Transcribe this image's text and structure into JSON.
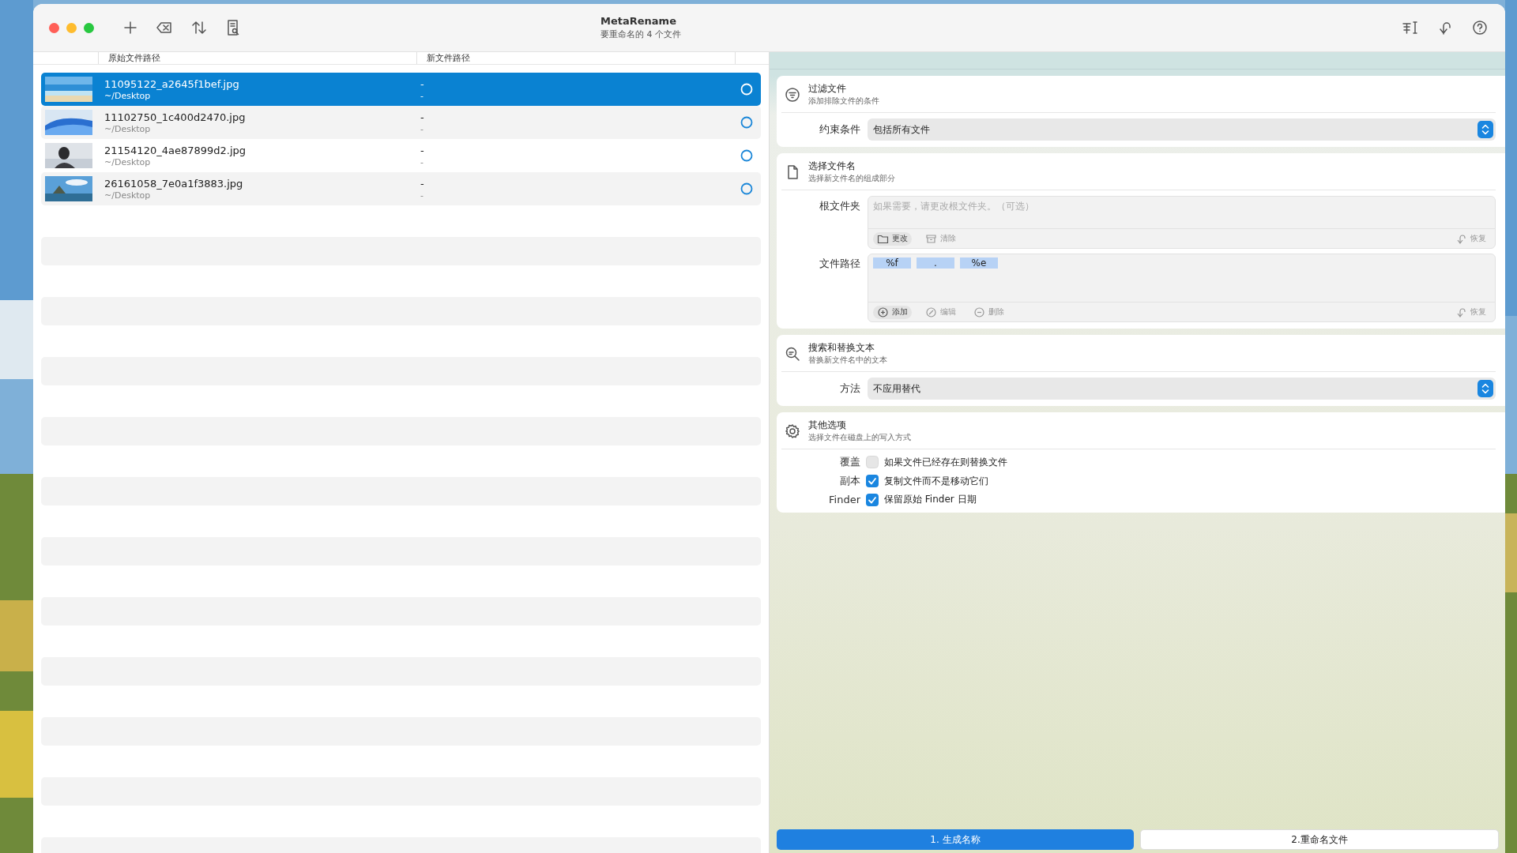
{
  "window": {
    "title": "MetaRename",
    "subtitle": "要重命名的 4 个文件"
  },
  "table": {
    "columns": [
      "原始文件路径",
      "新文件路径"
    ],
    "rows": [
      {
        "name": "11095122_a2645f1bef.jpg",
        "folder": "~/Desktop",
        "new_name": "-",
        "new_folder": "-",
        "selected": true
      },
      {
        "name": "11102750_1c400d2470.jpg",
        "folder": "~/Desktop",
        "new_name": "-",
        "new_folder": "-",
        "selected": false
      },
      {
        "name": "21154120_4ae87899d2.jpg",
        "folder": "~/Desktop",
        "new_name": "-",
        "new_folder": "-",
        "selected": false
      },
      {
        "name": "26161058_7e0a1f3883.jpg",
        "folder": "~/Desktop",
        "new_name": "-",
        "new_folder": "-",
        "selected": false
      }
    ]
  },
  "sections": [
    {
      "title": "过滤文件",
      "subtitle": "添加排除文件的条件",
      "fields": [
        {
          "kind": "select",
          "label": "约束条件",
          "value": "包括所有文件"
        }
      ]
    },
    {
      "title": "选择文件名",
      "subtitle": "选择新文件名的组成部分",
      "fields": [
        {
          "kind": "folder",
          "label": "根文件夹",
          "placeholder": "如果需要，请更改根文件夹。（可选）",
          "actions": [
            {
              "label": "更改",
              "disabled": false
            },
            {
              "label": "清除",
              "disabled": true
            }
          ],
          "reset": "恢复"
        },
        {
          "kind": "tokens",
          "label": "文件路径",
          "tokens": [
            "%f",
            ".",
            "%e"
          ],
          "actions": [
            {
              "label": "添加",
              "disabled": false
            },
            {
              "label": "编辑",
              "disabled": true
            },
            {
              "label": "删除",
              "disabled": true
            }
          ],
          "reset": "恢复"
        }
      ]
    },
    {
      "title": "搜索和替换文本",
      "subtitle": "替换新文件名中的文本",
      "fields": [
        {
          "kind": "select",
          "label": "方法",
          "value": "不应用替代"
        }
      ]
    },
    {
      "title": "其他选项",
      "subtitle": "选择文件在磁盘上的写入方式",
      "fields": [
        {
          "kind": "checkbox",
          "label": "覆盖",
          "text": "如果文件已经存在则替换文件",
          "checked": false
        },
        {
          "kind": "checkbox",
          "label": "副本",
          "text": "复制文件而不是移动它们",
          "checked": true
        },
        {
          "kind": "checkbox",
          "label": "Finder",
          "text": "保留原始 Finder 日期",
          "checked": true
        }
      ]
    }
  ],
  "buttons": [
    {
      "label": "1. 生成名称",
      "kind": "primary"
    },
    {
      "label": "2.重命名文件",
      "kind": "secondary"
    }
  ]
}
